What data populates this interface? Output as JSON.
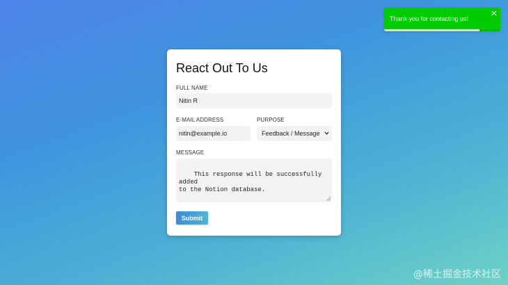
{
  "toast": {
    "message": "Thank you for contacting us!",
    "close_icon": "close-icon",
    "progress": 0.82,
    "color": "#00cc00"
  },
  "form": {
    "title": "React Out To Us",
    "full_name": {
      "label": "FULL NAME",
      "value": "Nitin R"
    },
    "email": {
      "label": "E-MAIL ADDRESS",
      "value": "nitin@example.io"
    },
    "purpose": {
      "label": "PURPOSE",
      "value": "Feedback / Message"
    },
    "message": {
      "label": "MESSAGE",
      "value": "This response will be successfully added\nto the Notion database."
    },
    "submit_label": "Submit"
  },
  "watermark": "@稀土掘金技术社区"
}
